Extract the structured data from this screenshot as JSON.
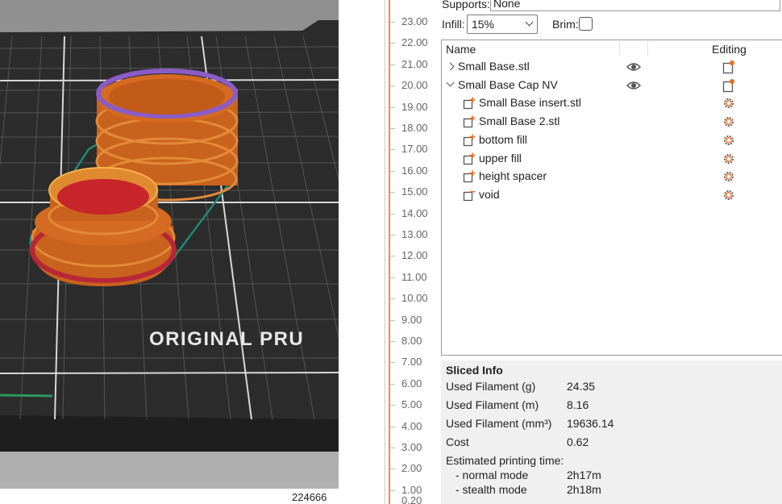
{
  "viewport": {
    "bed_text": "ORIGINAL PRU",
    "object_counter": "224666"
  },
  "ruler": {
    "ticks": [
      "23.00",
      "22.00",
      "21.00",
      "20.00",
      "19.00",
      "18.00",
      "17.00",
      "16.00",
      "15.00",
      "14.00",
      "13.00",
      "12.00",
      "11.00",
      "10.00",
      "9.00",
      "8.00",
      "7.00",
      "6.00",
      "5.00",
      "4.00",
      "3.00",
      "2.00",
      "1.00"
    ],
    "bottom_value": "0.20",
    "accent_color": "#f08a3c"
  },
  "settings": {
    "supports_label": "Supports:",
    "supports_value": "None",
    "infill_label": "Infill:",
    "infill_value": "15%",
    "brim_label": "Brim:",
    "brim_checked": false
  },
  "object_list": {
    "col_name": "Name",
    "col_editing": "Editing",
    "rows": [
      {
        "name": "Small Base.stl",
        "level": 0,
        "expander": "collapsed",
        "visible_icon": "eye-icon",
        "edit_icon": "object-settings-icon"
      },
      {
        "name": "Small Base Cap NV",
        "level": 0,
        "expander": "expanded",
        "visible_icon": "eye-icon",
        "edit_icon": "object-settings-icon"
      },
      {
        "name": "Small Base insert.stl",
        "level": 1,
        "icon": "add-part-icon",
        "edit_icon": "gear-icon"
      },
      {
        "name": "Small Base 2.stl",
        "level": 1,
        "icon": "add-part-icon",
        "edit_icon": "gear-icon"
      },
      {
        "name": "bottom fill",
        "level": 1,
        "icon": "add-part-icon",
        "edit_icon": "gear-icon"
      },
      {
        "name": "upper fill",
        "level": 1,
        "icon": "add-part-icon",
        "edit_icon": "gear-icon"
      },
      {
        "name": "height spacer",
        "level": 1,
        "icon": "add-part-icon",
        "edit_icon": "gear-icon"
      },
      {
        "name": "void",
        "level": 1,
        "icon": "negative-volume-icon",
        "edit_icon": "gear-icon"
      }
    ]
  },
  "sliced_info": {
    "title": "Sliced Info",
    "used_filament_g_label": "Used Filament (g)",
    "used_filament_g": "24.35",
    "used_filament_m_label": "Used Filament (m)",
    "used_filament_m": "8.16",
    "used_filament_mm3_label": "Used Filament (mm³)",
    "used_filament_mm3": "19636.14",
    "cost_label": "Cost",
    "cost": "0.62",
    "print_time_label": "Estimated printing time:",
    "normal_mode_label": "- normal mode",
    "normal_mode": "2h17m",
    "stealth_mode_label": "- stealth mode",
    "stealth_mode": "2h18m"
  }
}
